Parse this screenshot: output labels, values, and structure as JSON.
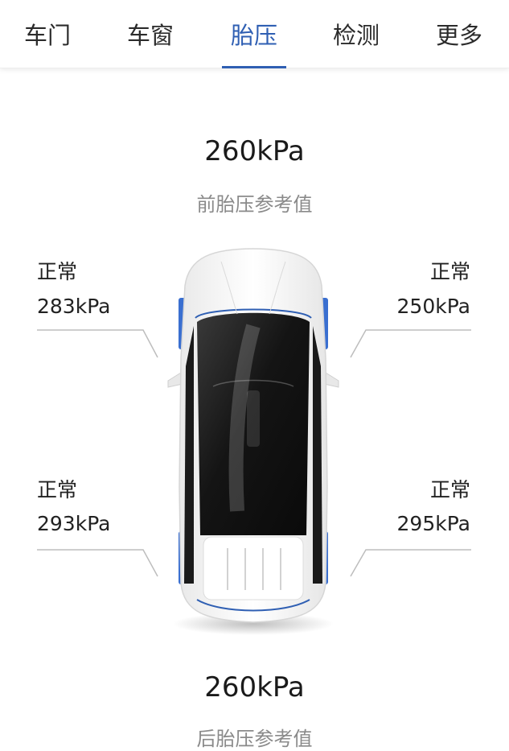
{
  "tabs": [
    {
      "label": "车门",
      "active": false
    },
    {
      "label": "车窗",
      "active": false
    },
    {
      "label": "胎压",
      "active": true
    },
    {
      "label": "检测",
      "active": false
    },
    {
      "label": "更多",
      "active": false
    }
  ],
  "accent_color": "#2f5fb3",
  "front_reference": {
    "value": "260kPa",
    "label": "前胎压参考值"
  },
  "rear_reference": {
    "value": "260kPa",
    "label": "后胎压参考值"
  },
  "tires": {
    "front_left": {
      "status": "正常",
      "pressure": "283kPa"
    },
    "front_right": {
      "status": "正常",
      "pressure": "250kPa"
    },
    "rear_left": {
      "status": "正常",
      "pressure": "293kPa"
    },
    "rear_right": {
      "status": "正常",
      "pressure": "295kPa"
    }
  }
}
